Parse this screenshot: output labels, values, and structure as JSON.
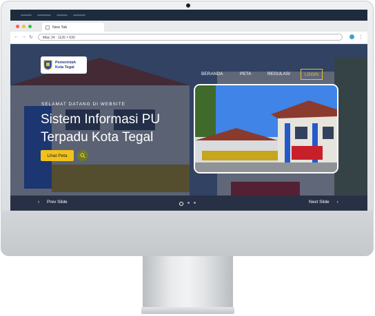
{
  "browser": {
    "tab_title": "New Tab",
    "address": "iMac 24 · 1120 × 630"
  },
  "site": {
    "logo": {
      "line1": "Pemerintah",
      "line2": "Kota Tegal"
    },
    "nav": [
      {
        "label": "BERANDA"
      },
      {
        "label": "PETA"
      },
      {
        "label": "REGULASI"
      }
    ],
    "login_label": "LOGIN",
    "eyebrow": "SELAMAT DATANG DI WEBSITE",
    "title_line1": "Sistem Informasi PU",
    "title_line2": "Terpadu Kota Tegal",
    "cta_label": "Lihat Peta",
    "search_icon": "search-icon",
    "prev_label": "Prev Slide",
    "next_label": "Next Slide",
    "slides": {
      "count": 3,
      "active": 1
    }
  },
  "colors": {
    "accent": "#f2c21b",
    "navy_overlay": "#16203a",
    "menubar": "#1d2b3d",
    "building_blue": "#2459c9"
  }
}
